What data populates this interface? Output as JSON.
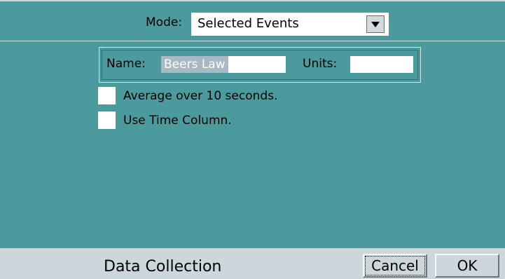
{
  "mode": {
    "label": "Mode:",
    "selected": "Selected Events"
  },
  "fields": {
    "name_label": "Name:",
    "name_value": "Beers Law",
    "units_label": "Units:",
    "units_value": ""
  },
  "options": {
    "average_label": "Average over 10 seconds.",
    "average_checked": false,
    "time_column_label": "Use Time Column.",
    "time_column_checked": false
  },
  "footer": {
    "title": "Data Collection",
    "cancel_label": "Cancel",
    "ok_label": "OK"
  },
  "icons": {
    "dropdown": "triangle-down-icon"
  },
  "colors": {
    "background": "#4a9a9e",
    "footer": "#cbd7db",
    "selection": "#a8b8c4"
  }
}
